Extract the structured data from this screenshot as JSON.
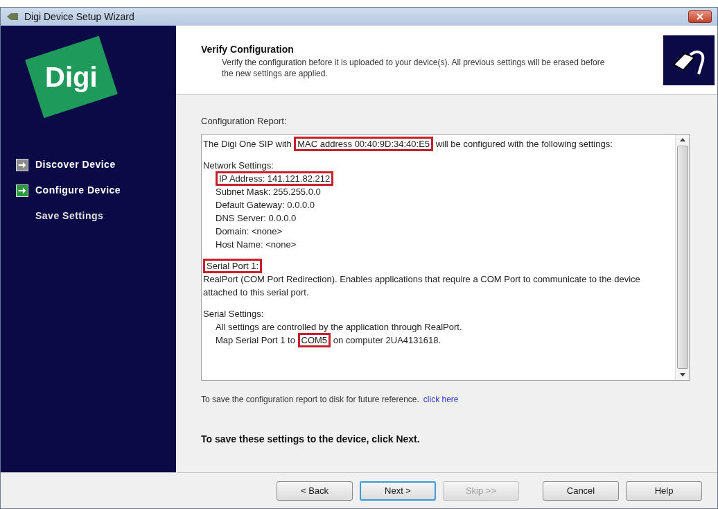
{
  "window": {
    "title": "Digi Device Setup Wizard"
  },
  "sidebar": {
    "logo": "Digi",
    "steps": [
      {
        "label": "Discover Device",
        "kind": "done"
      },
      {
        "label": "Configure Device",
        "kind": "current"
      },
      {
        "label": "Save Settings",
        "kind": "pending"
      }
    ]
  },
  "header": {
    "title": "Verify Configuration",
    "description": "Verify the configuration before it is uploaded to your device(s). All previous settings will be erased before the new settings are applied."
  },
  "report": {
    "label": "Configuration Report:",
    "blocks": [
      {
        "body": [
          {
            "text": "The Digi One SIP with ",
            "highlighted": false
          },
          {
            "text": "MAC address 00:40:9D:34:40:E5",
            "highlighted": true
          },
          {
            "text": " will be configured with the following settings:",
            "highlighted": false
          }
        ]
      },
      {
        "heading": [
          {
            "text": "Network Settings:",
            "highlighted": false
          }
        ],
        "children": [
          [
            {
              "text": "IP Address: 141.121.82.212",
              "highlighted": true
            }
          ],
          [
            {
              "text": "Subnet Mask: 255.255.0.0",
              "highlighted": false
            }
          ],
          [
            {
              "text": "Default Gateway: 0.0.0.0",
              "highlighted": false
            }
          ],
          [
            {
              "text": "DNS Server: 0.0.0.0",
              "highlighted": false
            }
          ],
          [
            {
              "text": "Domain: <none>",
              "highlighted": false
            }
          ],
          [
            {
              "text": "Host Name: <none>",
              "highlighted": false
            }
          ]
        ]
      },
      {
        "heading": [
          {
            "text": "Serial Port 1:",
            "highlighted": true
          }
        ],
        "body": [
          {
            "text": "RealPort (COM Port Redirection). Enables applications that require a COM Port to communicate to the device attached to this serial port.",
            "highlighted": false
          }
        ]
      },
      {
        "heading": [
          {
            "text": "Serial Settings:",
            "highlighted": false
          }
        ],
        "children": [
          [
            {
              "text": "All settings are controlled by the application through RealPort.",
              "highlighted": false
            }
          ],
          [
            {
              "text": "Map Serial Port 1 to ",
              "highlighted": false
            },
            {
              "text": "COM5",
              "highlighted": true
            },
            {
              "text": " on computer 2UA4131618.",
              "highlighted": false
            }
          ]
        ]
      }
    ]
  },
  "save_note": {
    "text": "To save the configuration report to disk for future reference.",
    "link": "click here"
  },
  "instruction": "To save these settings to the device, click Next.",
  "buttons": [
    {
      "label": "< Back",
      "default": false,
      "disabled": false
    },
    {
      "label": "Next >",
      "default": true,
      "disabled": false
    },
    {
      "label": "Skip >>",
      "default": false,
      "disabled": true
    },
    {
      "label": "Cancel",
      "default": false,
      "disabled": false
    },
    {
      "label": "Help",
      "default": false,
      "disabled": false
    }
  ]
}
